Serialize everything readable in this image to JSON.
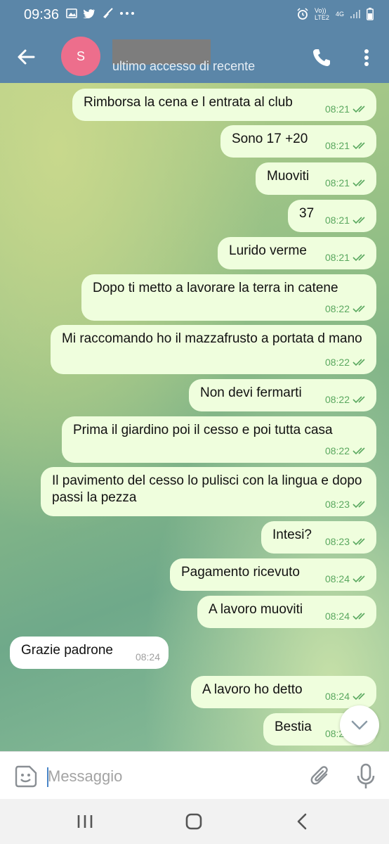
{
  "status_bar": {
    "time": "09:36",
    "signal_text": "Vo)) LTE2",
    "network": "4G"
  },
  "header": {
    "avatar_letter": "S",
    "last_seen": "ultimo accesso di recente"
  },
  "messages": [
    {
      "text": "Rimborsa la cena e l entrata al club",
      "time": "08:21",
      "dir": "out"
    },
    {
      "text": "Sono 17 +20",
      "time": "08:21",
      "dir": "out"
    },
    {
      "text": "Muoviti",
      "time": "08:21",
      "dir": "out"
    },
    {
      "text": "37",
      "time": "08:21",
      "dir": "out"
    },
    {
      "text": "Lurido verme",
      "time": "08:21",
      "dir": "out"
    },
    {
      "text": "Dopo ti metto a lavorare la terra in catene",
      "time": "08:22",
      "dir": "out"
    },
    {
      "text": "Mi raccomando ho il mazzafrusto a portata d mano",
      "time": "08:22",
      "dir": "out"
    },
    {
      "text": "Non devi fermarti",
      "time": "08:22",
      "dir": "out"
    },
    {
      "text": "Prima il giardino poi il cesso e poi tutta casa",
      "time": "08:22",
      "dir": "out"
    },
    {
      "text": "Il pavimento del cesso lo pulisci con la lingua e dopo passi la pezza",
      "time": "08:23",
      "dir": "out"
    },
    {
      "text": "Intesi?",
      "time": "08:23",
      "dir": "out"
    },
    {
      "text": "Pagamento ricevuto",
      "time": "08:24",
      "dir": "out"
    },
    {
      "text": "A lavoro muoviti",
      "time": "08:24",
      "dir": "out"
    },
    {
      "text": "Grazie padrone",
      "time": "08:24",
      "dir": "in"
    },
    {
      "text": "A lavoro ho detto",
      "time": "08:24",
      "dir": "out"
    },
    {
      "text": "Bestia",
      "time": "08:25",
      "dir": "out"
    }
  ],
  "input": {
    "placeholder": "Messaggio"
  },
  "colors": {
    "header": "#5b86a8",
    "outgoing_bubble": "#effedd",
    "incoming_bubble": "#ffffff",
    "check": "#5aa85f",
    "avatar": "#ed6e8c"
  },
  "icons": [
    "back-arrow-icon",
    "phone-icon",
    "more-vert-icon",
    "sticker-icon",
    "paperclip-icon",
    "microphone-icon",
    "chevron-down-icon"
  ]
}
